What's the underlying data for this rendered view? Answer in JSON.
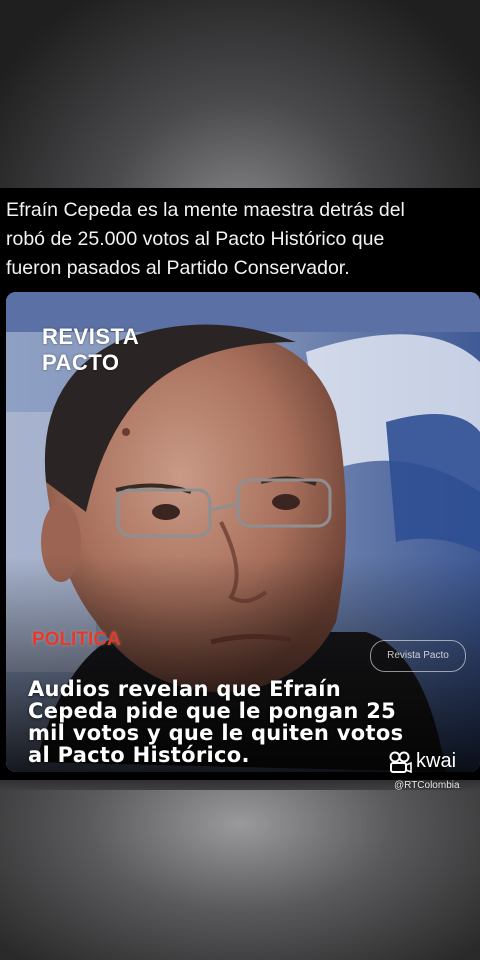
{
  "post": {
    "caption_lines": [
      "Efraín Cepeda es la mente maestra detrás del",
      "robó de 25.000 votos al Pacto Histórico que",
      "fueron pasados al Partido Conservador."
    ]
  },
  "card": {
    "brand_lines": [
      "REVISTA",
      "PACTO"
    ],
    "section_label": "POLITICA",
    "source_pill": "Revista Pacto",
    "headline_lines": [
      "Audios revelan que Efraín",
      "Cepeda pide que le pongan 25",
      "mil votos y que le quiten votos",
      "al Pacto Histórico."
    ]
  },
  "watermark": {
    "app_name": "kwai",
    "icon": "kwai-logo-icon",
    "handle": "@RTColombia"
  }
}
